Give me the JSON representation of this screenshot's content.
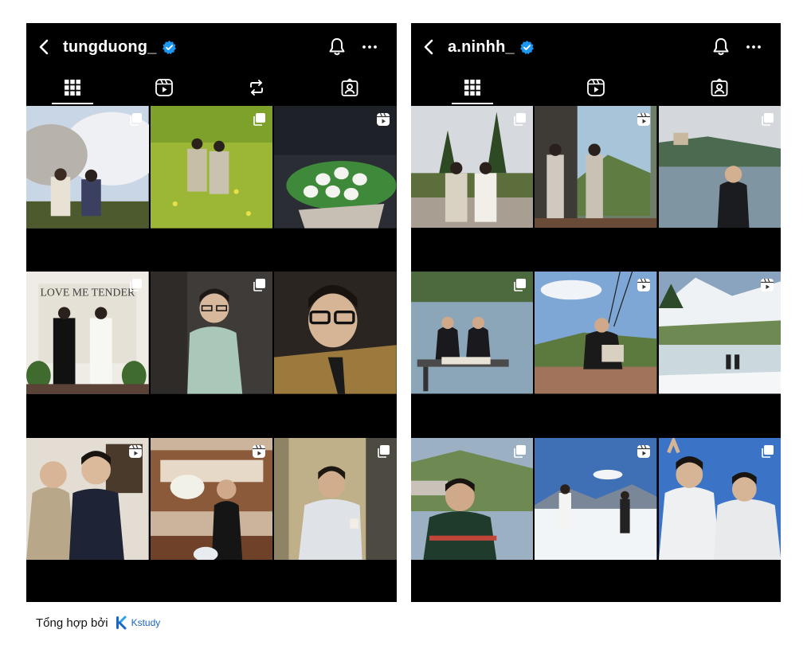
{
  "profiles": [
    {
      "username": "tungduong_",
      "verified": true,
      "tabs": [
        "posts-grid",
        "reels",
        "reposts",
        "tagged"
      ],
      "posts": [
        {
          "type": "carousel",
          "scene": "two men under cherry blossom tree"
        },
        {
          "type": "carousel",
          "scene": "two men in yellow flower field"
        },
        {
          "type": "reel",
          "scene": "bouquet of white tulips"
        },
        {
          "type": "carousel",
          "scene": "two men in suits, LOVE ME TENDER sign"
        },
        {
          "type": "carousel",
          "scene": "man in mint sweater with glasses"
        },
        {
          "type": "none",
          "scene": "selfie with black glasses, gold shirt"
        },
        {
          "type": "reel",
          "scene": "two men posing indoors"
        },
        {
          "type": "reel",
          "scene": "man with white flowers in kitchen"
        },
        {
          "type": "carousel",
          "scene": "man with glasses holding cup"
        }
      ]
    },
    {
      "username": "a.ninhh_",
      "verified": true,
      "tabs": [
        "posts-grid",
        "reels",
        "tagged"
      ],
      "posts": [
        {
          "type": "carousel",
          "scene": "two men in cream suits in garden"
        },
        {
          "type": "reel",
          "scene": "two men by window with mountains"
        },
        {
          "type": "carousel",
          "scene": "man by alpine lake"
        },
        {
          "type": "carousel",
          "scene": "two men sitting on pier by lake"
        },
        {
          "type": "reel",
          "scene": "tandem paragliding"
        },
        {
          "type": "reel",
          "scene": "snowy mountain lake"
        },
        {
          "type": "carousel",
          "scene": "man in green sweater in valley"
        },
        {
          "type": "reel",
          "scene": "two men on snowy mountain top"
        },
        {
          "type": "carousel",
          "scene": "two men in white puffer jackets"
        }
      ]
    }
  ],
  "footer": {
    "label": "Tổng hợp bởi",
    "brand": "Kstudy"
  },
  "colors": {
    "background": "#000000",
    "text": "#ffffff",
    "verified": "#1c96f0",
    "brand": "#1b64c8"
  }
}
